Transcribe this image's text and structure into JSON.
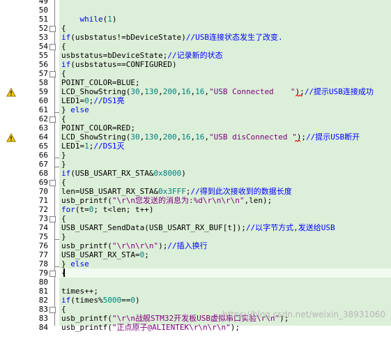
{
  "editor": {
    "lines": [
      {
        "no": "49",
        "segs": []
      },
      {
        "no": "50",
        "segs": []
      },
      {
        "no": "51",
        "segs": [
          {
            "t": "    "
          },
          {
            "t": "while",
            "c": "k"
          },
          {
            "t": "("
          },
          {
            "t": "1",
            "c": "n"
          },
          {
            "t": ")"
          }
        ]
      },
      {
        "no": "52",
        "segs": [
          {
            "t": "{"
          }
        ]
      },
      {
        "no": "53",
        "segs": [
          {
            "t": "if",
            "c": "k"
          },
          {
            "t": "(usbstatus!=bDeviceState)"
          },
          {
            "t": "//USB连接状态发生了改变.",
            "c": "c"
          }
        ]
      },
      {
        "no": "54",
        "segs": [
          {
            "t": "{"
          }
        ]
      },
      {
        "no": "55",
        "segs": [
          {
            "t": "usbstatus=bDeviceState;"
          },
          {
            "t": "//记录新的状态",
            "c": "c"
          }
        ]
      },
      {
        "no": "56",
        "segs": [
          {
            "t": "if",
            "c": "k"
          },
          {
            "t": "(usbstatus==CONFIGURED)"
          }
        ]
      },
      {
        "no": "57",
        "segs": [
          {
            "t": "{"
          }
        ]
      },
      {
        "no": "58",
        "segs": [
          {
            "t": "POINT_COLOR=BLUE;"
          }
        ]
      },
      {
        "no": "59",
        "segs": [
          {
            "t": "LCD_ShowString("
          },
          {
            "t": "30",
            "c": "n"
          },
          {
            "t": ","
          },
          {
            "t": "130",
            "c": "n"
          },
          {
            "t": ","
          },
          {
            "t": "200",
            "c": "n"
          },
          {
            "t": ","
          },
          {
            "t": "16",
            "c": "n"
          },
          {
            "t": ","
          },
          {
            "t": "16",
            "c": "n"
          },
          {
            "t": ","
          },
          {
            "t": "\"USB Connected  　\"",
            "c": "s"
          },
          {
            "t": ");"
          },
          {
            "t": "//提示USB连接成功",
            "c": "c"
          }
        ]
      },
      {
        "no": "60",
        "segs": [
          {
            "t": "LED1="
          },
          {
            "t": "0",
            "c": "n"
          },
          {
            "t": ";"
          },
          {
            "t": "//DS1亮",
            "c": "c"
          }
        ]
      },
      {
        "no": "61",
        "segs": [
          {
            "t": "} "
          },
          {
            "t": "else",
            "c": "k"
          }
        ]
      },
      {
        "no": "62",
        "segs": [
          {
            "t": "{"
          }
        ]
      },
      {
        "no": "63",
        "segs": [
          {
            "t": "POINT_COLOR=RED;"
          }
        ]
      },
      {
        "no": "64",
        "segs": [
          {
            "t": "LCD_ShowString("
          },
          {
            "t": "30",
            "c": "n"
          },
          {
            "t": ","
          },
          {
            "t": "130",
            "c": "n"
          },
          {
            "t": ","
          },
          {
            "t": "200",
            "c": "n"
          },
          {
            "t": ","
          },
          {
            "t": "16",
            "c": "n"
          },
          {
            "t": ","
          },
          {
            "t": "16",
            "c": "n"
          },
          {
            "t": ","
          },
          {
            "t": "\"USB disConnected \"",
            "c": "s"
          },
          {
            "t": ");"
          },
          {
            "t": "//提示USB断开",
            "c": "c"
          }
        ]
      },
      {
        "no": "65",
        "segs": [
          {
            "t": "LED1="
          },
          {
            "t": "1",
            "c": "n"
          },
          {
            "t": ";"
          },
          {
            "t": "//DS1灭",
            "c": "c"
          }
        ]
      },
      {
        "no": "66",
        "segs": [
          {
            "t": "}"
          }
        ]
      },
      {
        "no": "67",
        "segs": [
          {
            "t": "}"
          }
        ]
      },
      {
        "no": "68",
        "segs": [
          {
            "t": "if",
            "c": "k"
          },
          {
            "t": "(USB_USART_RX_STA&"
          },
          {
            "t": "0x8000",
            "c": "n"
          },
          {
            "t": ")"
          }
        ]
      },
      {
        "no": "69",
        "segs": [
          {
            "t": "{"
          }
        ]
      },
      {
        "no": "70",
        "segs": [
          {
            "t": "len=USB_USART_RX_STA&"
          },
          {
            "t": "0x3FFF",
            "c": "n"
          },
          {
            "t": ";"
          },
          {
            "t": "//得到此次接收到的数据长度",
            "c": "c"
          }
        ]
      },
      {
        "no": "71",
        "segs": [
          {
            "t": "usb_printf("
          },
          {
            "t": "\"\\r\\n您发送的消息为:%d\\r\\n\\r\\n\"",
            "c": "s"
          },
          {
            "t": ",len);"
          }
        ]
      },
      {
        "no": "72",
        "segs": [
          {
            "t": "for",
            "c": "k"
          },
          {
            "t": "(t="
          },
          {
            "t": "0",
            "c": "n"
          },
          {
            "t": "; t<len; t++)"
          }
        ]
      },
      {
        "no": "73",
        "segs": [
          {
            "t": "{"
          }
        ]
      },
      {
        "no": "74",
        "segs": [
          {
            "t": "USB_USART_SendData(USB_USART_RX_BUF[t]);"
          },
          {
            "t": "//以字节方式,发送给USB",
            "c": "c"
          }
        ]
      },
      {
        "no": "75",
        "segs": [
          {
            "t": "}"
          }
        ]
      },
      {
        "no": "76",
        "segs": [
          {
            "t": "usb_printf("
          },
          {
            "t": "\"\\r\\n\\r\\n\"",
            "c": "s"
          },
          {
            "t": ");"
          },
          {
            "t": "//插入换行",
            "c": "c"
          }
        ]
      },
      {
        "no": "77",
        "segs": [
          {
            "t": "USB_USART_RX_STA="
          },
          {
            "t": "0",
            "c": "n"
          },
          {
            "t": ";"
          }
        ]
      },
      {
        "no": "78",
        "segs": [
          {
            "t": "} "
          },
          {
            "t": "else",
            "c": "k"
          }
        ]
      },
      {
        "no": "79",
        "segs": [
          {
            "t": "{"
          }
        ]
      },
      {
        "no": "80",
        "segs": []
      },
      {
        "no": "81",
        "segs": [
          {
            "t": "times++;"
          }
        ]
      },
      {
        "no": "82",
        "segs": [
          {
            "t": "if",
            "c": "k"
          },
          {
            "t": "(times%"
          },
          {
            "t": "5000",
            "c": "n"
          },
          {
            "t": "=="
          },
          {
            "t": "0",
            "c": "n"
          },
          {
            "t": ")"
          }
        ]
      },
      {
        "no": "83",
        "segs": [
          {
            "t": "{"
          }
        ]
      },
      {
        "no": "83",
        "segs": [
          {
            "t": "usb_printf("
          },
          {
            "t": "\"\\r\\n战舰STM32开发板USB虚拟串口实验\\r\\n\"",
            "c": "s"
          },
          {
            "t": ");"
          }
        ]
      },
      {
        "no": "84",
        "segs": [
          {
            "t": "usb_printf("
          },
          {
            "t": "\"正点原子@ALIENTEK\\r\\n\\r\\n\"",
            "c": "s"
          },
          {
            "t": ");"
          }
        ]
      },
      {
        "no": "",
        "segs": []
      }
    ],
    "warnings": [
      "warning-icon",
      "warning-icon"
    ],
    "watermark": "https://blog.csdn.net/weixin_38931060"
  },
  "colors": {
    "background": "#dcefd8",
    "keyword": "#0000ff",
    "number": "#008080",
    "string": "#800080",
    "comment": "#0000ff",
    "current_line": "#f2fbef"
  }
}
